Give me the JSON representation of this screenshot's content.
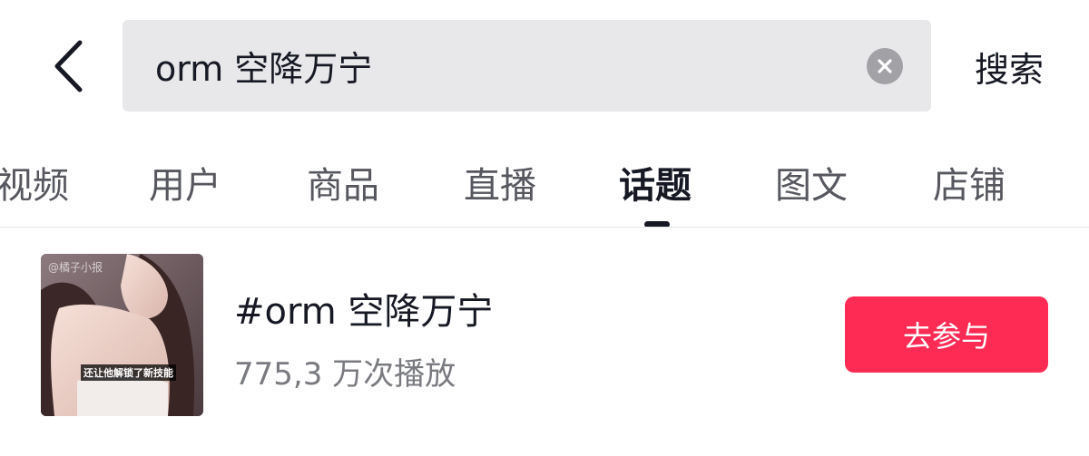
{
  "header": {
    "back_icon": "chevron-left-icon",
    "search": {
      "value": "orm 空降万宁",
      "placeholder": ""
    },
    "clear_icon": "close-circle-icon",
    "search_action_label": "搜索"
  },
  "tabs": [
    {
      "label": "视频",
      "active": false
    },
    {
      "label": "用户",
      "active": false
    },
    {
      "label": "商品",
      "active": false
    },
    {
      "label": "直播",
      "active": false
    },
    {
      "label": "话题",
      "active": true
    },
    {
      "label": "图文",
      "active": false
    },
    {
      "label": "店铺",
      "active": false
    }
  ],
  "results": [
    {
      "thumbnail": {
        "watermark": "@橘子小报",
        "caption": "还让他解锁了新技能"
      },
      "title": "#orm 空降万宁",
      "meta": "775,3 万次播放",
      "action_label": "去参与"
    }
  ],
  "colors": {
    "accent": "#fe2c55",
    "text_primary": "#161823",
    "text_secondary": "#7a7b80",
    "search_bg": "#e8e8ea"
  }
}
